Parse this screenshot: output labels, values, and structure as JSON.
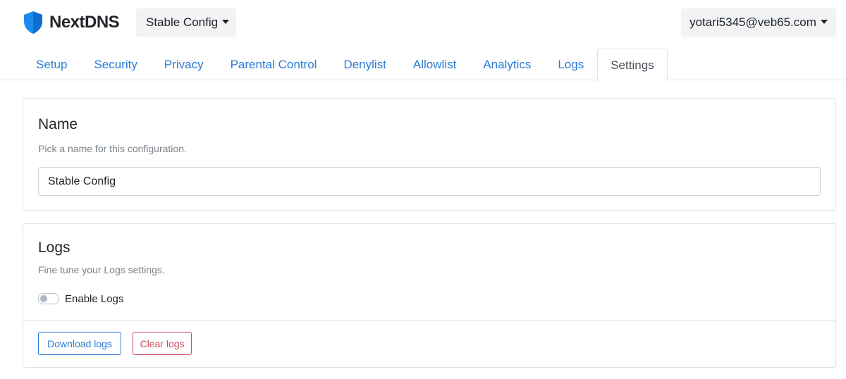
{
  "brand": {
    "name": "NextDNS",
    "logo_icon": "shield-icon",
    "logo_color": "#1a8cf0"
  },
  "header": {
    "config_selector": "Stable Config",
    "account": "yotari5345@veb65.com"
  },
  "tabs": [
    {
      "label": "Setup",
      "active": false
    },
    {
      "label": "Security",
      "active": false
    },
    {
      "label": "Privacy",
      "active": false
    },
    {
      "label": "Parental Control",
      "active": false
    },
    {
      "label": "Denylist",
      "active": false
    },
    {
      "label": "Allowlist",
      "active": false
    },
    {
      "label": "Analytics",
      "active": false
    },
    {
      "label": "Logs",
      "active": false
    },
    {
      "label": "Settings",
      "active": true
    }
  ],
  "name_section": {
    "title": "Name",
    "description": "Pick a name for this configuration.",
    "input_value": "Stable Config"
  },
  "logs_section": {
    "title": "Logs",
    "description": "Fine tune your Logs settings.",
    "toggle_label": "Enable Logs",
    "toggle_on": false,
    "download_label": "Download logs",
    "clear_label": "Clear logs"
  },
  "colors": {
    "link": "#2b7bd6",
    "danger": "#d0495a"
  }
}
